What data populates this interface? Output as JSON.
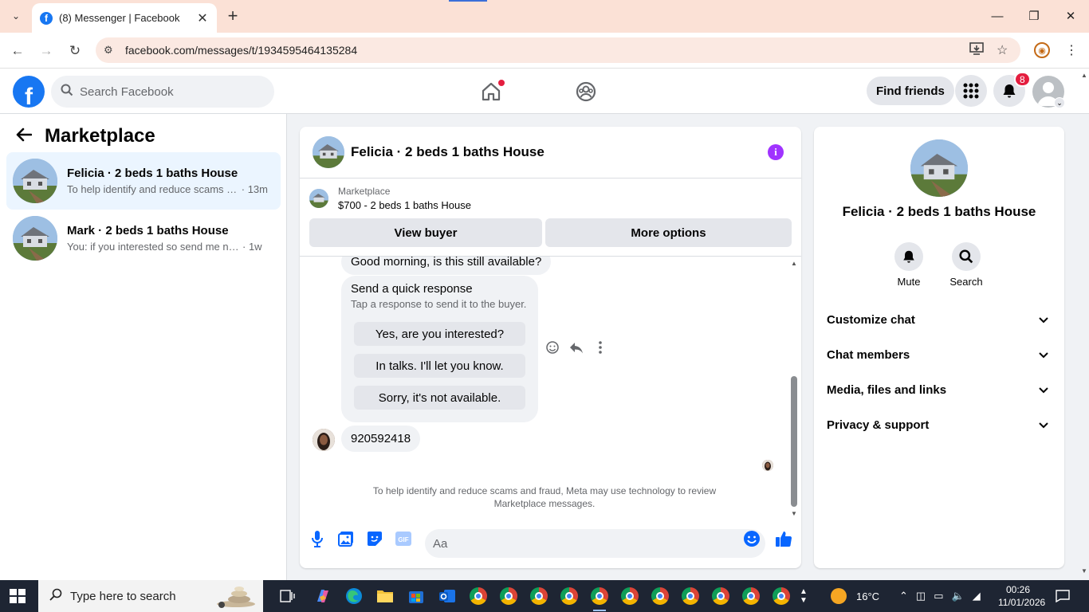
{
  "browser": {
    "tab_title": "(8) Messenger | Facebook",
    "url": "facebook.com/messages/t/1934595464135284"
  },
  "fb": {
    "search_placeholder": "Search Facebook",
    "find_friends": "Find friends",
    "notif_count": "8"
  },
  "marketplace": {
    "title": "Marketplace",
    "conversations": [
      {
        "name": "Felicia · 2 beds 1 baths House",
        "snippet": "To help identify and reduce scams a...",
        "time": "· 13m"
      },
      {
        "name": "Mark · 2 beds 1 baths House",
        "snippet": "You: if you interested so send me nu...",
        "time": "· 1w"
      }
    ]
  },
  "chat": {
    "title": "Felicia · 2 beds 1 baths House",
    "listing_category": "Marketplace",
    "listing_price": "$700 - 2 beds 1 baths House",
    "view_buyer": "View buyer",
    "more_options": "More options",
    "first_message": "Good morning, is this still available?",
    "quick_response_title": "Send a quick response",
    "quick_response_sub": "Tap a response to send it to the buyer.",
    "quick_responses": [
      "Yes, are you interested?",
      "In talks. I'll let you know.",
      "Sorry, it's not available."
    ],
    "last_message": "920592418",
    "notice": "To help identify and reduce scams and fraud, Meta may use technology to review Marketplace messages.",
    "input_placeholder": "Aa"
  },
  "details": {
    "name": "Felicia · 2 beds 1 baths House",
    "mute": "Mute",
    "search": "Search",
    "sections": [
      "Customize chat",
      "Chat members",
      "Media, files and links",
      "Privacy & support"
    ]
  },
  "taskbar": {
    "search_placeholder": "Type here to search",
    "weather": "16°C",
    "time": "00:26",
    "date": "11/01/2026"
  },
  "colors": {
    "fb_blue": "#1877f2",
    "messenger_blue": "#0866ff",
    "info_purple": "#a033ff",
    "badge_red": "#e41e3f"
  }
}
